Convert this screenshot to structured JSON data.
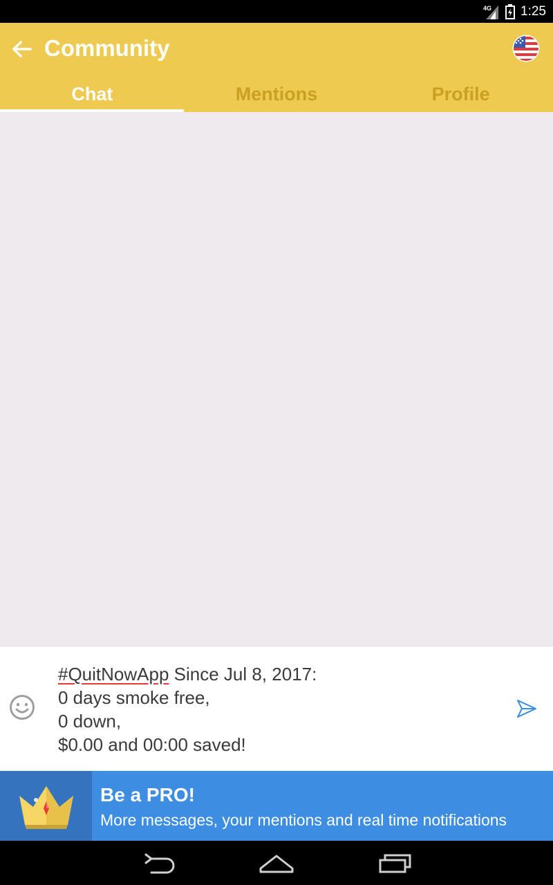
{
  "status_bar": {
    "time": "1:25",
    "network": "4G"
  },
  "app_bar": {
    "title": "Community"
  },
  "tabs": [
    {
      "label": "Chat",
      "active": true
    },
    {
      "label": "Mentions",
      "active": false
    },
    {
      "label": "Profile",
      "active": false
    }
  ],
  "composer": {
    "hashtag": "#QuitNowApp",
    "line1_rest": " Since Jul 8, 2017:",
    "line2": "0 days smoke free,",
    "line3": "0 down,",
    "line4": "$0.00 and 00:00 saved!"
  },
  "pro_banner": {
    "title": "Be a PRO!",
    "subtitle": "More messages, your mentions and real time notifications"
  },
  "colors": {
    "app_bar": "#efca51",
    "tab_inactive": "#c9a01f",
    "chat_background": "#efeaee",
    "pro_banner": "#3d8ee2",
    "send_accent": "#3b8fe0"
  },
  "icons": {
    "back": "back-arrow-icon",
    "flag": "us-flag-icon",
    "emoji": "emoji-icon",
    "send": "send-icon",
    "crown": "crown-icon"
  }
}
